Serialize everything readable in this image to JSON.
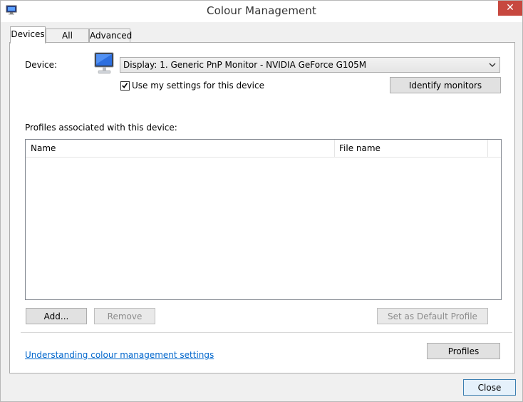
{
  "window": {
    "title": "Colour Management",
    "close_glyph": "✕",
    "app_icon": "color-management-icon"
  },
  "tabs": [
    {
      "label": "Devices",
      "active": true
    },
    {
      "label": "All Profiles",
      "active": false
    },
    {
      "label": "Advanced",
      "active": false
    }
  ],
  "device": {
    "label": "Device:",
    "icon": "monitor-icon",
    "selected": "Display: 1. Generic PnP Monitor - NVIDIA GeForce G105M",
    "use_my_settings_label": "Use my settings for this device",
    "use_my_settings_checked": true,
    "identify_button": "Identify monitors"
  },
  "profiles": {
    "label": "Profiles associated with this device:",
    "columns": [
      "Name",
      "File name"
    ],
    "rows": [],
    "add_button": "Add...",
    "remove_button": "Remove",
    "set_default_button": "Set as Default Profile"
  },
  "footer": {
    "link_text": "Understanding colour management settings",
    "profiles_button": "Profiles",
    "close_button": "Close"
  },
  "colors": {
    "close_red": "#c7483f",
    "link_blue": "#0066cc",
    "default_button_border": "#3c7fb1"
  }
}
